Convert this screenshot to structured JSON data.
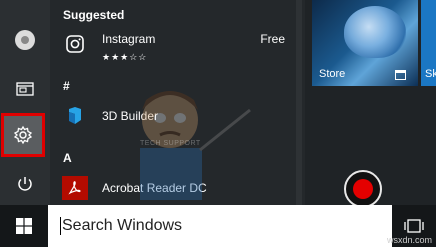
{
  "start_menu": {
    "sections": {
      "suggested": "Suggested",
      "hash": "#",
      "a": "A"
    },
    "apps": [
      {
        "name": "Instagram",
        "price": "Free",
        "rating": "★★★☆☆"
      },
      {
        "name": "3D Builder"
      },
      {
        "name": "Acrobat Reader DC"
      }
    ],
    "tiles": {
      "store_label": "Store",
      "partial_label": "Sk"
    }
  },
  "rail": {
    "items": [
      "user-avatar",
      "documents",
      "settings",
      "power"
    ],
    "selected": "settings"
  },
  "taskbar": {
    "search_text": "Search Windows"
  },
  "watermark": {
    "text": "TECH SUPPORT"
  },
  "site_label": "wsxdn.com",
  "colors": {
    "highlight": "#e00000",
    "tile_blue": "#1b77c4",
    "record_red": "#e40000"
  }
}
